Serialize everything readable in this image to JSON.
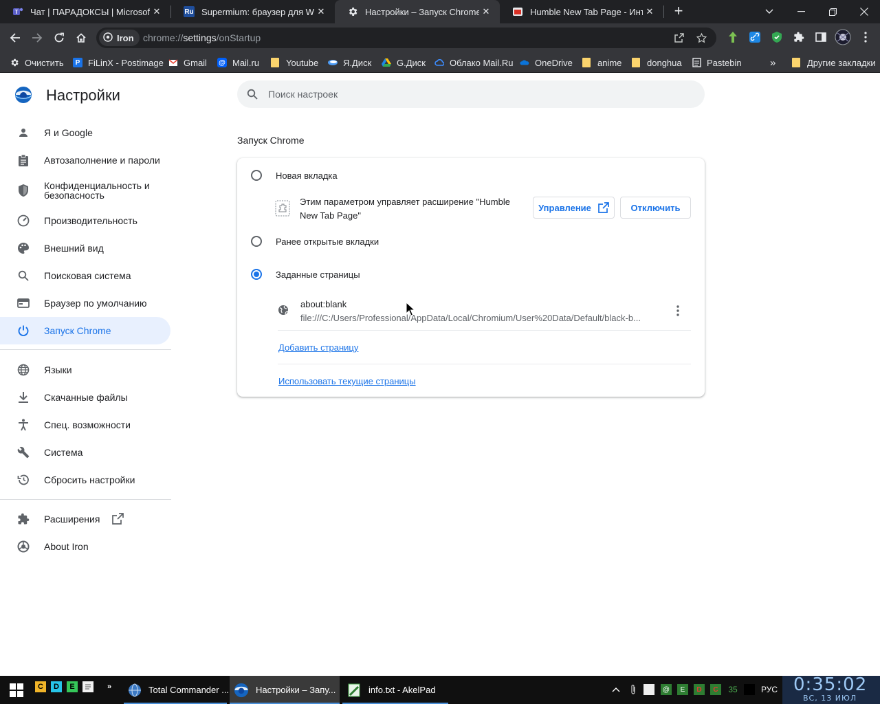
{
  "tabs": [
    {
      "title": "Чат | ПАРАДОКСЫ | Microsoft Teams",
      "icon": "teams-icon",
      "active": false
    },
    {
      "title": "Supermium: браузер для Windows",
      "icon": "ru-site-icon",
      "active": false
    },
    {
      "title": "Настройки – Запуск Chrome",
      "icon": "settings-gear-icon",
      "active": true
    },
    {
      "title": "Humble New Tab Page - Интернет-магазин Chrome",
      "icon": "humble-icon",
      "active": false
    }
  ],
  "toolbar": {
    "chip_label": "Iron",
    "url_scheme": "chrome://",
    "url_host": "settings",
    "url_path": "/onStartup"
  },
  "bookmarks": [
    {
      "label": "Очистить",
      "icon": "gear-icon"
    },
    {
      "label": "FiLinX - Postimage",
      "icon": "postimage-icon"
    },
    {
      "label": "Gmail",
      "icon": "gmail-icon"
    },
    {
      "label": "Mail.ru",
      "icon": "mailru-icon"
    },
    {
      "label": "Youtube",
      "icon": "folder-icon"
    },
    {
      "label": "Я.Диск",
      "icon": "yadisk-icon"
    },
    {
      "label": "G.Диск",
      "icon": "gdrive-icon"
    },
    {
      "label": "Облако Mail.Ru",
      "icon": "cloud-icon"
    },
    {
      "label": "OneDrive",
      "icon": "onedrive-icon"
    },
    {
      "label": "anime",
      "icon": "folder-icon"
    },
    {
      "label": "donghua",
      "icon": "folder-icon"
    },
    {
      "label": "Pastebin",
      "icon": "pastebin-icon"
    }
  ],
  "bookmarks_overflow": "»",
  "other_bookmarks": "Другие закладки",
  "settings": {
    "title": "Настройки",
    "search_placeholder": "Поиск настроек",
    "nav": [
      {
        "label": "Я и Google",
        "icon": "person-icon"
      },
      {
        "label": "Автозаполнение и пароли",
        "icon": "clipboard-icon"
      },
      {
        "label": "Конфиденциальность и безопасность",
        "icon": "shield-icon"
      },
      {
        "label": "Производительность",
        "icon": "speedometer-icon"
      },
      {
        "label": "Внешний вид",
        "icon": "palette-icon"
      },
      {
        "label": "Поисковая система",
        "icon": "search-icon"
      },
      {
        "label": "Браузер по умолчанию",
        "icon": "browser-icon"
      },
      {
        "label": "Запуск Chrome",
        "icon": "power-icon",
        "active": true
      },
      {
        "label": "Языки",
        "icon": "globe-icon"
      },
      {
        "label": "Скачанные файлы",
        "icon": "download-icon"
      },
      {
        "label": "Спец. возможности",
        "icon": "accessibility-icon"
      },
      {
        "label": "Система",
        "icon": "wrench-icon"
      },
      {
        "label": "Сбросить настройки",
        "icon": "history-icon"
      },
      {
        "label": "Расширения",
        "icon": "puzzle-icon"
      },
      {
        "label": "About Iron",
        "icon": "iron-logo-icon"
      }
    ],
    "section_title": "Запуск Chrome",
    "options": [
      {
        "label": "Новая вкладка",
        "checked": false
      },
      {
        "label": "Ранее открытые вкладки",
        "checked": false
      },
      {
        "label": "Заданные страницы",
        "checked": true
      }
    ],
    "policy_text": "Этим параметром управляет расширение \"Humble New Tab Page\"",
    "manage_button": "Управление",
    "disable_button": "Отключить",
    "startup_page": {
      "title": "about:blank",
      "url": "file:///C:/Users/Professional/AppData/Local/Chromium/User%20Data/Default/black-b..."
    },
    "add_page_link": "Добавить страницу",
    "use_current_link": "Использовать текущие страницы"
  },
  "taskbar": {
    "quicklaunch": [
      "C",
      "D",
      "E"
    ],
    "tasks": [
      {
        "label": "Total Commander ...",
        "icon": "total-commander-icon",
        "active": false
      },
      {
        "label": "Настройки – Запу...",
        "icon": "iron-browser-icon",
        "active": true
      },
      {
        "label": "info.txt - AkelPad",
        "icon": "akelpad-icon",
        "active": false
      }
    ],
    "tray_counter": "35",
    "language": "РУС",
    "time": "0:35:02",
    "date": "ВС, 13  ИЮЛ"
  },
  "colors": {
    "accent": "#1a73e8",
    "active_nav_bg": "#e8f0fe",
    "chrome_dark": "#35363a",
    "tabstrip_bg": "#202124"
  }
}
